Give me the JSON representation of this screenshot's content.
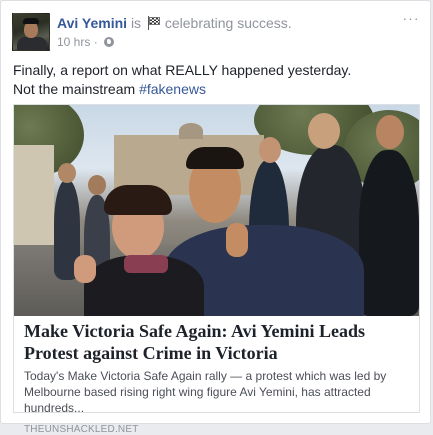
{
  "post": {
    "author": "Avi Yemini",
    "connector": "is",
    "activity": "celebrating success.",
    "activity_icon": "checkered-flag-icon",
    "timestamp": "10 hrs",
    "separator": "·",
    "privacy_icon": "globe-icon",
    "more_label": "···",
    "text_lines": [
      "Finally, a report on what REALLY happened yesterday.",
      "Not the mainstream "
    ],
    "hashtag": "#fakenews"
  },
  "link_card": {
    "title": "Make Victoria Safe Again: Avi Yemini Leads Protest against Crime in Victoria",
    "description": "Today's Make Victoria Safe Again rally — a protest which was led by Melbourne based rising right wing figure Avi Yemini, has attracted hundreds...",
    "domain": "THEUNSHACKLED.NET"
  },
  "colors": {
    "link_blue": "#365899",
    "text": "#1d2129",
    "secondary_text": "#90949c",
    "background": "#e9ebee"
  }
}
